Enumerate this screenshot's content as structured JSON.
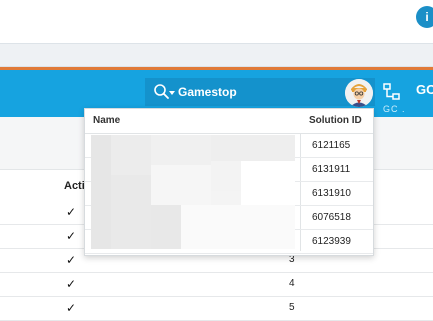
{
  "top": {
    "badge": "i"
  },
  "header": {
    "search_value": "Gamestop",
    "user_initials": "GC",
    "sub_text": "GC ."
  },
  "table": {
    "active_header": "Acti",
    "rows": [
      {
        "check": "✓",
        "number": ""
      },
      {
        "check": "✓",
        "number": ""
      },
      {
        "check": "✓",
        "number": "3"
      },
      {
        "check": "✓",
        "number": "4"
      },
      {
        "check": "✓",
        "number": "5"
      }
    ]
  },
  "dropdown": {
    "name_header": "Name",
    "id_header": "Solution ID",
    "rows": [
      {
        "solution_id": "6121165"
      },
      {
        "solution_id": "6131911"
      },
      {
        "solution_id": "6131910"
      },
      {
        "solution_id": "6076518"
      },
      {
        "solution_id": "6123939"
      }
    ]
  },
  "colors": {
    "header_blue": "#16a3e0",
    "search_blue": "#1492cc",
    "accent_orange": "#e07a38"
  },
  "icons": [
    "search-icon",
    "chevron-down-icon",
    "avatar",
    "org-chart-icon"
  ]
}
